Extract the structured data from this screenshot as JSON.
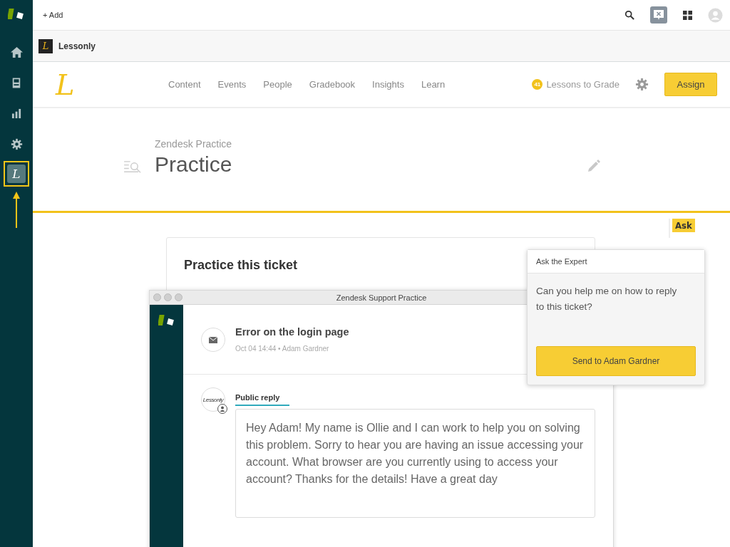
{
  "topbar": {
    "add_label": "+ Add"
  },
  "app_sidebar": {
    "items": [
      {
        "kind": "home",
        "selected": false
      },
      {
        "kind": "inbox",
        "selected": false
      },
      {
        "kind": "chart",
        "selected": false
      },
      {
        "kind": "settings",
        "selected": false
      },
      {
        "kind": "app",
        "letter": "L",
        "selected": true
      }
    ]
  },
  "tab": {
    "logo_letter": "L",
    "label": "Lessonly"
  },
  "lessonly_header": {
    "logo_letter": "L",
    "nav": [
      {
        "label": "Content"
      },
      {
        "label": "Events"
      },
      {
        "label": "People"
      },
      {
        "label": "Gradebook"
      },
      {
        "label": "Insights"
      },
      {
        "label": "Learn"
      }
    ],
    "grade_count": "41",
    "grade_label": "Lessons to Grade",
    "assign_button": "Assign"
  },
  "page": {
    "breadcrumb": "Zendesk Practice",
    "title": "Practice"
  },
  "card": {
    "title": "Practice this ticket"
  },
  "practice_window": {
    "title": "Zendesk Support Practice",
    "ticket": {
      "subject": "Error on the login page",
      "meta": "Oct 04 14:44 • Adam Gardner"
    },
    "reply": {
      "avatar_text": "Lessonly",
      "tab": "Public reply",
      "value": "Hey Adam! My name is Ollie and I can work to help you on solving this problem. Sorry to hear you are having an issue accessing your account. What browser are you currently using to access your account? Thanks for the details! Have a great day"
    }
  },
  "ask": {
    "badge": "Ask",
    "title": "Ask the Expert",
    "question": "Can you help me on how to reply to this ticket?",
    "send_button": "Send to Adam Gardner"
  }
}
